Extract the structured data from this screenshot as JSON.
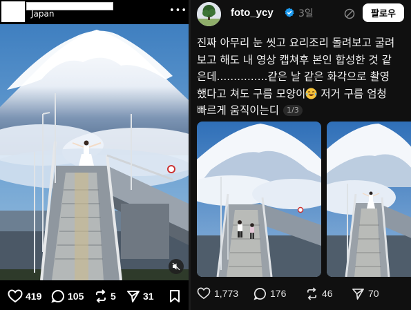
{
  "left_post": {
    "location": "Japan",
    "more_label": "•••",
    "stats": {
      "likes": "419",
      "comments": "105",
      "reposts": "5",
      "shares": "31"
    }
  },
  "right_post": {
    "username": "foto_ycy",
    "time": "3일",
    "follow_label": "팔로우",
    "caption_lines": [
      "진짜 아무리 눈 씻고 요리조리 돌려보고 굴려",
      "보고 해도 내 영상 캡쳐후 본인 합성한 것 같",
      "은데...............같은 날 같은 화각으로 촬영",
      "했다고 쳐도 구름 모양이",
      " 저거 구름 엄청",
      "빠르게 움직이는디"
    ],
    "emoji": "crying-laughing-emoji",
    "image_counter": "1/3",
    "stats": {
      "likes": "1,773",
      "comments": "176",
      "reposts": "46",
      "shares": "70"
    }
  },
  "colors": {
    "background": "#000000",
    "panel": "#101010",
    "muted": "#8a8a8a",
    "verified": "#1d9bf0",
    "sky": "#5a8cc4"
  }
}
